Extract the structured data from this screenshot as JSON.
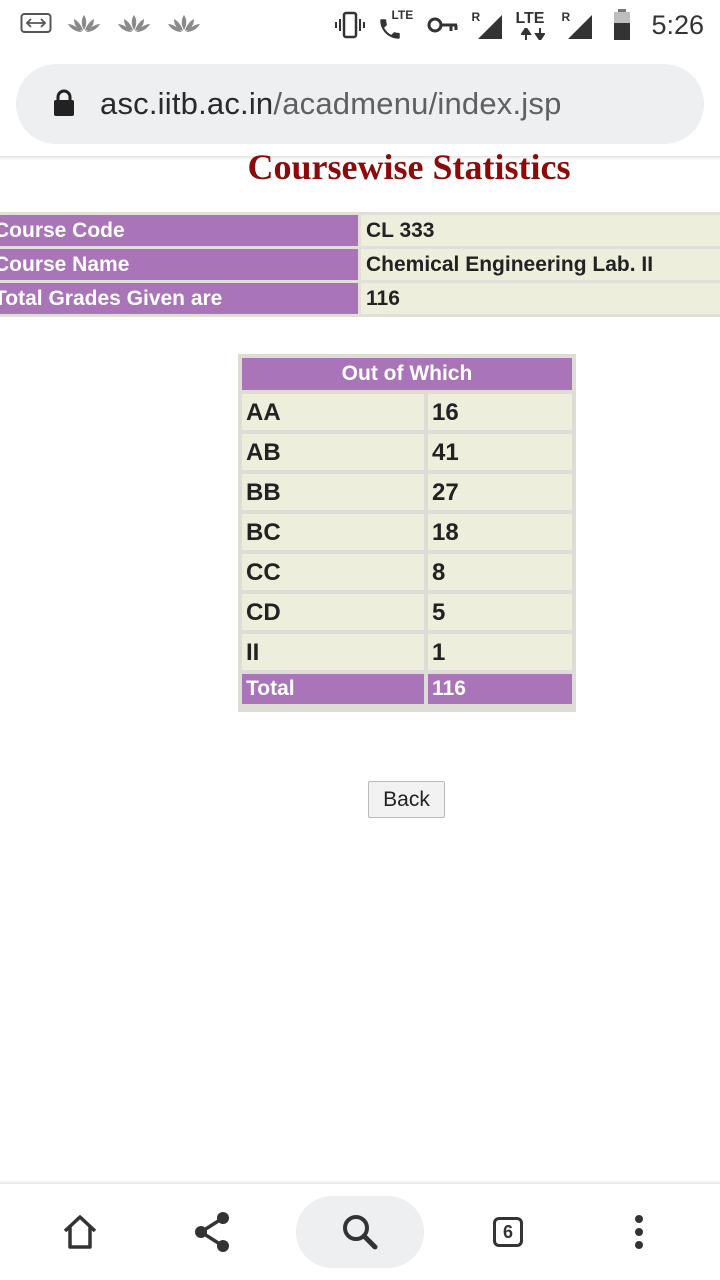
{
  "status_bar": {
    "time": "5:26",
    "lte_label": "LTE",
    "lte_label_2": "LTE",
    "roaming_label": "R",
    "roaming_label_2": "R",
    "icons": [
      "keyboard-icon",
      "lotus-icon",
      "lotus-icon",
      "lotus-icon",
      "vibrate-icon",
      "volte-call-icon",
      "vpn-key-icon",
      "signal-icon",
      "signal-icon",
      "battery-icon"
    ]
  },
  "browser": {
    "url_host": "asc.iitb.ac.in",
    "url_path": "/acadmenu/index.jsp",
    "tab_count": "6"
  },
  "page": {
    "title": "Coursewise Statistics",
    "info_rows": [
      {
        "label": "Course Code",
        "value": "CL 333"
      },
      {
        "label": "Course Name",
        "value": "Chemical Engineering Lab. II"
      },
      {
        "label": "Total Grades Given are",
        "value": "116"
      }
    ],
    "grade_table": {
      "header": "Out of Which",
      "rows": [
        {
          "grade": "AA",
          "count": "16"
        },
        {
          "grade": "AB",
          "count": "41"
        },
        {
          "grade": "BB",
          "count": "27"
        },
        {
          "grade": "BC",
          "count": "18"
        },
        {
          "grade": "CC",
          "count": "8"
        },
        {
          "grade": "CD",
          "count": "5"
        },
        {
          "grade": "II",
          "count": "1"
        }
      ],
      "total_label": "Total",
      "total_value": "116"
    },
    "back_label": "Back"
  },
  "colors": {
    "title": "#8b0a0a",
    "label_bg": "#a975b8",
    "cell_bg": "#eeeedc"
  }
}
